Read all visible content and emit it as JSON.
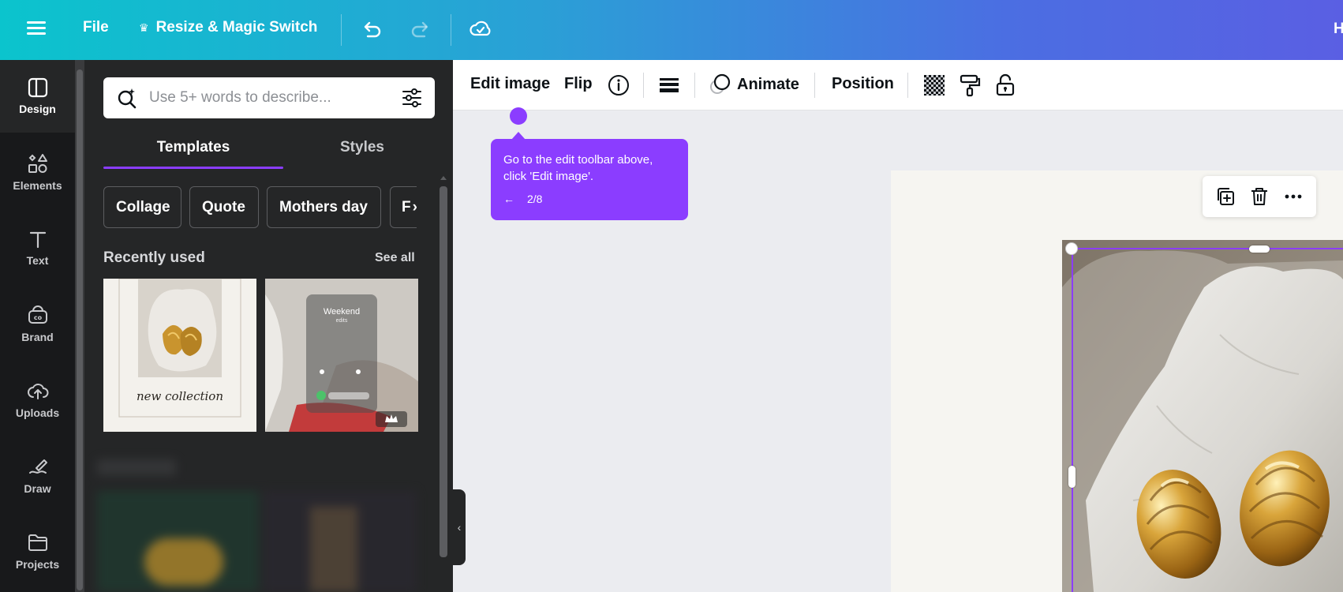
{
  "topbar": {
    "file_label": "File",
    "resize_label": "Resize & Magic Switch",
    "cut_label": "H",
    "menu_icon": "hamburger-icon",
    "undo_icon": "undo-icon",
    "redo_icon": "redo-icon",
    "cloud_icon": "cloud-saved-icon"
  },
  "rail": {
    "items": [
      {
        "label": "Design",
        "icon": "design-icon"
      },
      {
        "label": "Elements",
        "icon": "elements-icon"
      },
      {
        "label": "Text",
        "icon": "text-icon"
      },
      {
        "label": "Brand",
        "icon": "brand-icon"
      },
      {
        "label": "Uploads",
        "icon": "uploads-icon"
      },
      {
        "label": "Draw",
        "icon": "draw-icon"
      },
      {
        "label": "Projects",
        "icon": "projects-icon"
      }
    ]
  },
  "panel": {
    "search_placeholder": "Use 5+ words to describe...",
    "tabs": [
      "Templates",
      "Styles"
    ],
    "chips": [
      "Collage",
      "Quote",
      "Mothers day",
      "F"
    ],
    "recently_used": "Recently used",
    "see_all": "See all",
    "template1_caption": "new collection",
    "template2_title": "Weekend",
    "template2_sub": "edits"
  },
  "edit_toolbar": {
    "edit_image": "Edit image",
    "flip": "Flip",
    "animate": "Animate",
    "position": "Position"
  },
  "tooltip": {
    "message": "Go to the edit toolbar above, click 'Edit image'.",
    "step": "2/8"
  },
  "colors": {
    "accent": "#8b3dff",
    "panel": "#252627",
    "rail": "#18191b",
    "canvas_bg": "#ebecf0"
  }
}
